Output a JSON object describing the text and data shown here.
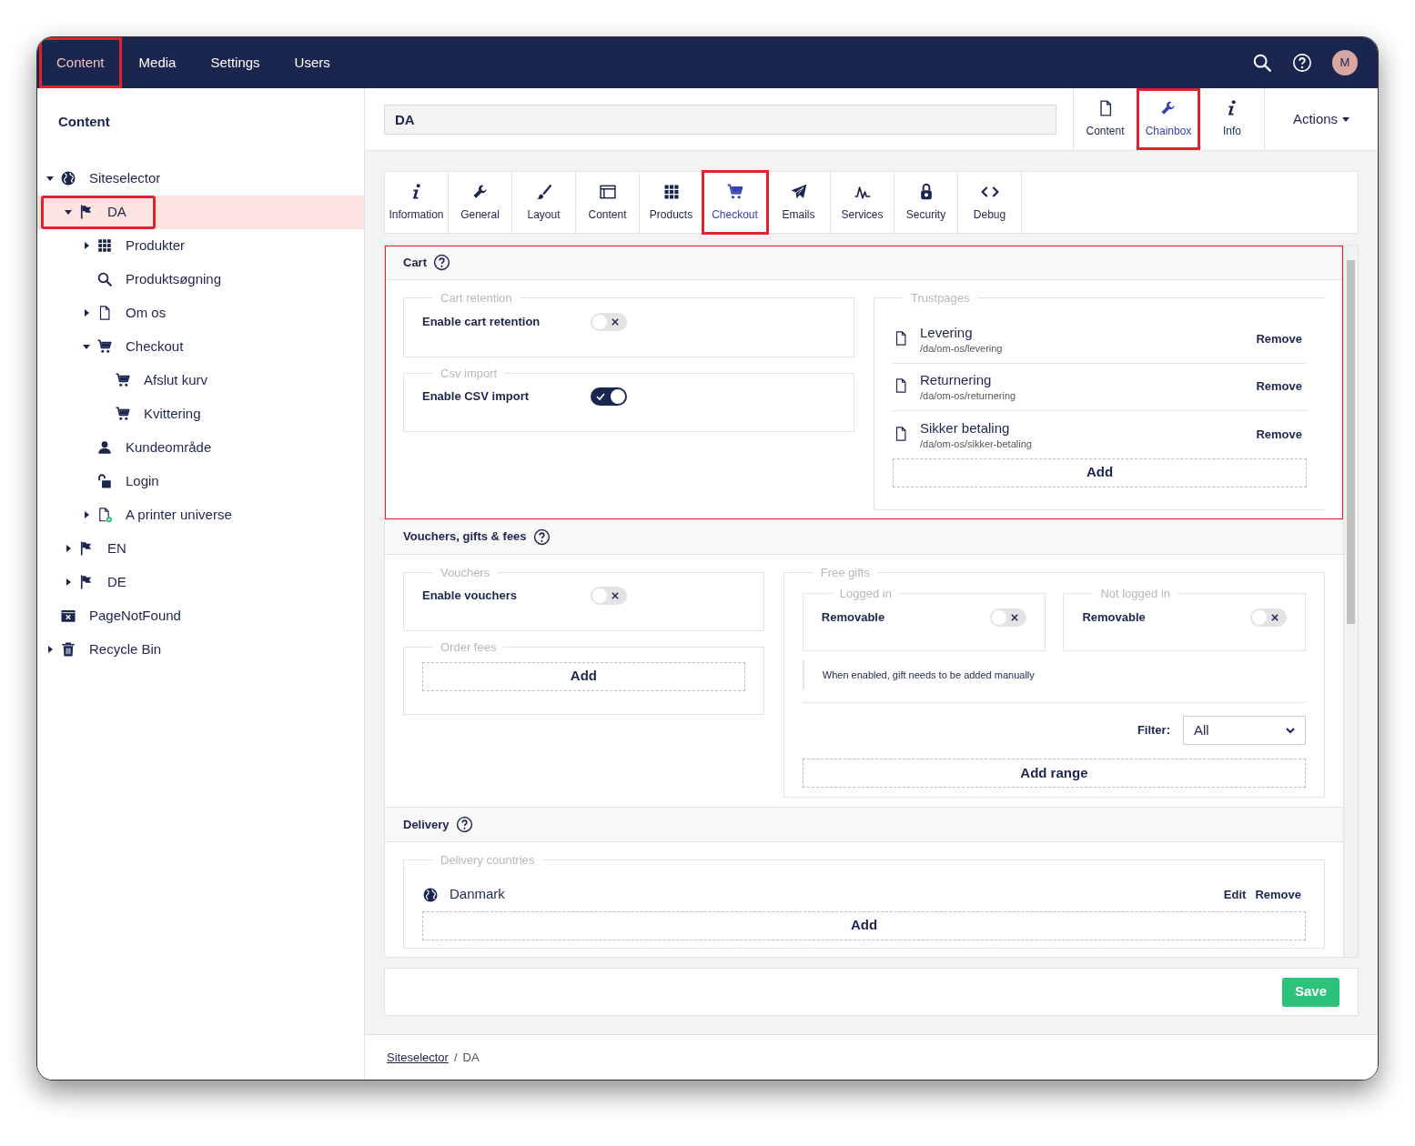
{
  "top_nav": {
    "items": [
      {
        "label": "Content",
        "selected": true,
        "highlighted": true
      },
      {
        "label": "Media",
        "selected": false,
        "highlighted": false
      },
      {
        "label": "Settings",
        "selected": false,
        "highlighted": false
      },
      {
        "label": "Users",
        "selected": false,
        "highlighted": false
      }
    ],
    "avatar": "M"
  },
  "sidebar": {
    "title": "Content",
    "tree": [
      {
        "label": "Siteselector",
        "kind": "globe",
        "expanded": true,
        "selected": false,
        "highlighted": false,
        "children": [
          {
            "label": "DA",
            "kind": "flag",
            "expanded": true,
            "selected": true,
            "highlighted": true,
            "children": [
              {
                "label": "Produkter",
                "kind": "grid",
                "expanded": false,
                "selected": false,
                "highlighted": false
              },
              {
                "label": "Produktsøgning",
                "kind": "search",
                "selected": false,
                "highlighted": false
              },
              {
                "label": "Om os",
                "kind": "page",
                "expanded": false,
                "selected": false,
                "highlighted": false
              },
              {
                "label": "Checkout",
                "kind": "cart",
                "expanded": true,
                "selected": false,
                "highlighted": false,
                "children": [
                  {
                    "label": "Afslut kurv",
                    "kind": "cart",
                    "selected": false,
                    "highlighted": false
                  },
                  {
                    "label": "Kvittering",
                    "kind": "cart",
                    "selected": false,
                    "highlighted": false
                  }
                ]
              },
              {
                "label": "Kundeområde",
                "kind": "user",
                "selected": false,
                "highlighted": false
              },
              {
                "label": "Login",
                "kind": "unlock",
                "selected": false,
                "highlighted": false
              },
              {
                "label": "A printer universe",
                "kind": "page-add",
                "expanded": false,
                "selected": false,
                "highlighted": false
              }
            ]
          },
          {
            "label": "EN",
            "kind": "flag",
            "expanded": false,
            "selected": false,
            "highlighted": false
          },
          {
            "label": "DE",
            "kind": "flag",
            "expanded": false,
            "selected": false,
            "highlighted": false
          }
        ]
      },
      {
        "label": "PageNotFound",
        "kind": "window-x",
        "selected": false,
        "highlighted": false
      },
      {
        "label": "Recycle Bin",
        "kind": "trash",
        "expanded": false,
        "selected": false,
        "highlighted": false
      }
    ]
  },
  "editor": {
    "name_field": "DA",
    "apps": [
      {
        "label": "Content",
        "kind": "page",
        "selected": false,
        "highlighted": false
      },
      {
        "label": "Chainbox",
        "kind": "wrench",
        "selected": true,
        "highlighted": true
      },
      {
        "label": "Info",
        "kind": "info",
        "selected": false,
        "highlighted": false
      }
    ],
    "actions": "Actions",
    "tabs": [
      {
        "label": "Information",
        "kind": "info",
        "selected": false,
        "highlighted": false
      },
      {
        "label": "General",
        "kind": "wrench",
        "selected": false,
        "highlighted": false
      },
      {
        "label": "Layout",
        "kind": "brush",
        "selected": false,
        "highlighted": false
      },
      {
        "label": "Content",
        "kind": "window",
        "selected": false,
        "highlighted": false
      },
      {
        "label": "Products",
        "kind": "grid",
        "selected": false,
        "highlighted": false
      },
      {
        "label": "Checkout",
        "kind": "cart",
        "selected": true,
        "highlighted": true
      },
      {
        "label": "Emails",
        "kind": "send",
        "selected": false,
        "highlighted": false
      },
      {
        "label": "Services",
        "kind": "pulse",
        "selected": false,
        "highlighted": false
      },
      {
        "label": "Security",
        "kind": "lock",
        "selected": false,
        "highlighted": false
      },
      {
        "label": "Debug",
        "kind": "code",
        "selected": false,
        "highlighted": false
      }
    ],
    "sections": [
      {
        "title": "Cart",
        "highlighted": true,
        "columns": [
          [
            {
              "kind": "toggle",
              "legend": "Cart retention",
              "label": "Enable cart retention",
              "on": false
            },
            {
              "kind": "toggle",
              "legend": "Csv import",
              "label": "Enable CSV import",
              "on": true
            }
          ],
          [
            {
              "kind": "pages",
              "legend": "Trustpages",
              "pages": [
                {
                  "name": "Levering",
                  "path": "/da/om-os/levering",
                  "action": "Remove"
                },
                {
                  "name": "Returnering",
                  "path": "/da/om-os/returnering",
                  "action": "Remove"
                },
                {
                  "name": "Sikker betaling",
                  "path": "/da/om-os/sikker-betaling",
                  "action": "Remove"
                }
              ],
              "add": "Add"
            }
          ]
        ]
      },
      {
        "title": "Vouchers, gifts & fees",
        "highlighted": false,
        "columns": [
          [
            {
              "kind": "toggle",
              "legend": "Vouchers",
              "label": "Enable vouchers",
              "on": false
            },
            {
              "kind": "add",
              "legend": "Order fees",
              "add": "Add"
            }
          ],
          [
            {
              "kind": "gifts",
              "legend": "Free gifts",
              "groups": [
                {
                  "legend": "Logged in",
                  "label": "Removable",
                  "on": false
                },
                {
                  "legend": "Not logged in",
                  "label": "Removable",
                  "on": false
                }
              ],
              "note": "When enabled, gift needs to be added manually",
              "filter_label": "Filter:",
              "filter_value": "All",
              "add": "Add range"
            }
          ]
        ]
      },
      {
        "title": "Delivery",
        "highlighted": false,
        "columns": [
          [
            {
              "kind": "countries",
              "legend": "Delivery countries",
              "countries": [
                {
                  "name": "Danmark",
                  "actions": [
                    "Edit",
                    "Remove"
                  ]
                }
              ],
              "add": "Add"
            }
          ]
        ]
      }
    ],
    "save": "Save"
  },
  "breadcrumb": [
    {
      "label": "Siteselector",
      "link": true
    },
    {
      "label": "/",
      "link": false
    },
    {
      "label": "DA",
      "link": false
    }
  ]
}
